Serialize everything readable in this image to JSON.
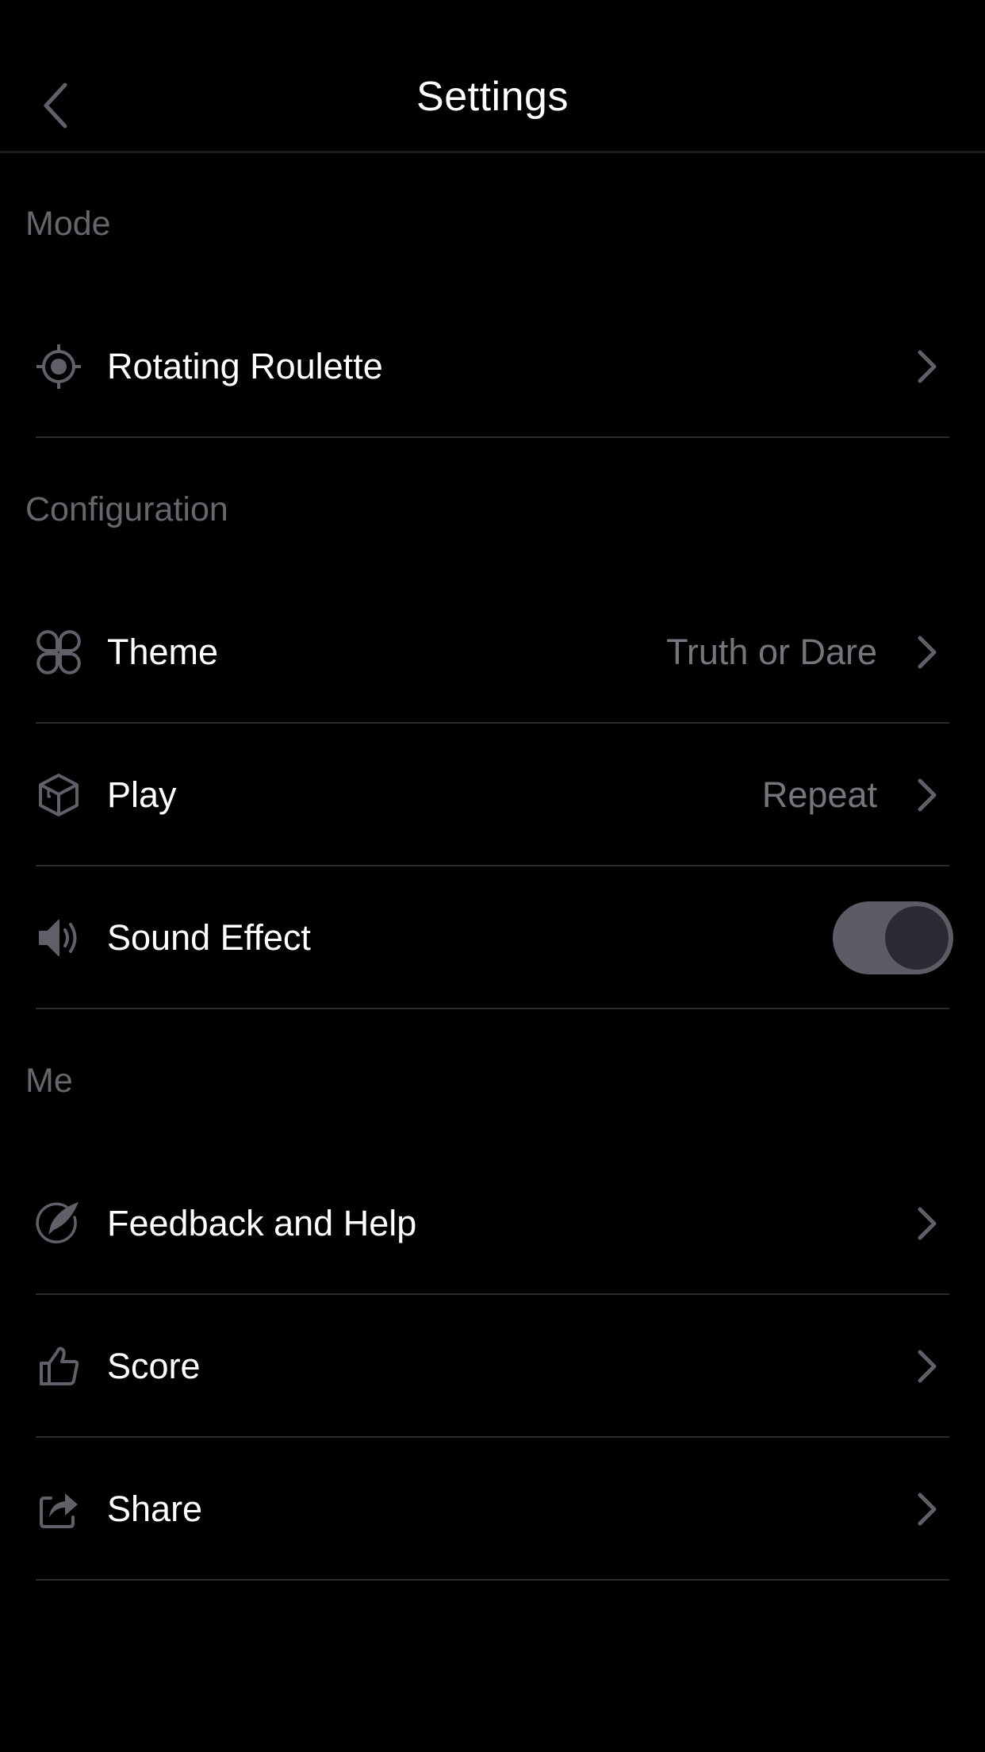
{
  "header": {
    "title": "Settings",
    "back_icon": "chevron-left-icon"
  },
  "colors": {
    "background": "#000000",
    "text_primary": "#ffffff",
    "text_secondary": "#75757c",
    "section_label": "#66666c",
    "icon": "#5f6068",
    "divider": "#2a2a30",
    "toggle_track": "#5b5c64",
    "toggle_knob": "#2a2a33"
  },
  "sections": [
    {
      "label": "Mode",
      "items": [
        {
          "label": "Rotating Roulette",
          "icon": "target-icon",
          "value": null,
          "chevron": true
        }
      ]
    },
    {
      "label": "Configuration",
      "items": [
        {
          "label": "Theme",
          "icon": "clover-icon",
          "value": "Truth or Dare",
          "chevron": true
        },
        {
          "label": "Play",
          "icon": "cube-icon",
          "value": "Repeat",
          "chevron": true
        },
        {
          "label": "Sound Effect",
          "icon": "speaker-icon",
          "toggle": true,
          "toggle_on": true
        }
      ]
    },
    {
      "label": "Me",
      "items": [
        {
          "label": "Feedback and Help",
          "icon": "feather-pen-icon",
          "value": null,
          "chevron": true
        },
        {
          "label": "Score",
          "icon": "thumbs-up-icon",
          "value": null,
          "chevron": true
        },
        {
          "label": "Share",
          "icon": "share-icon",
          "value": null,
          "chevron": true
        }
      ]
    }
  ]
}
